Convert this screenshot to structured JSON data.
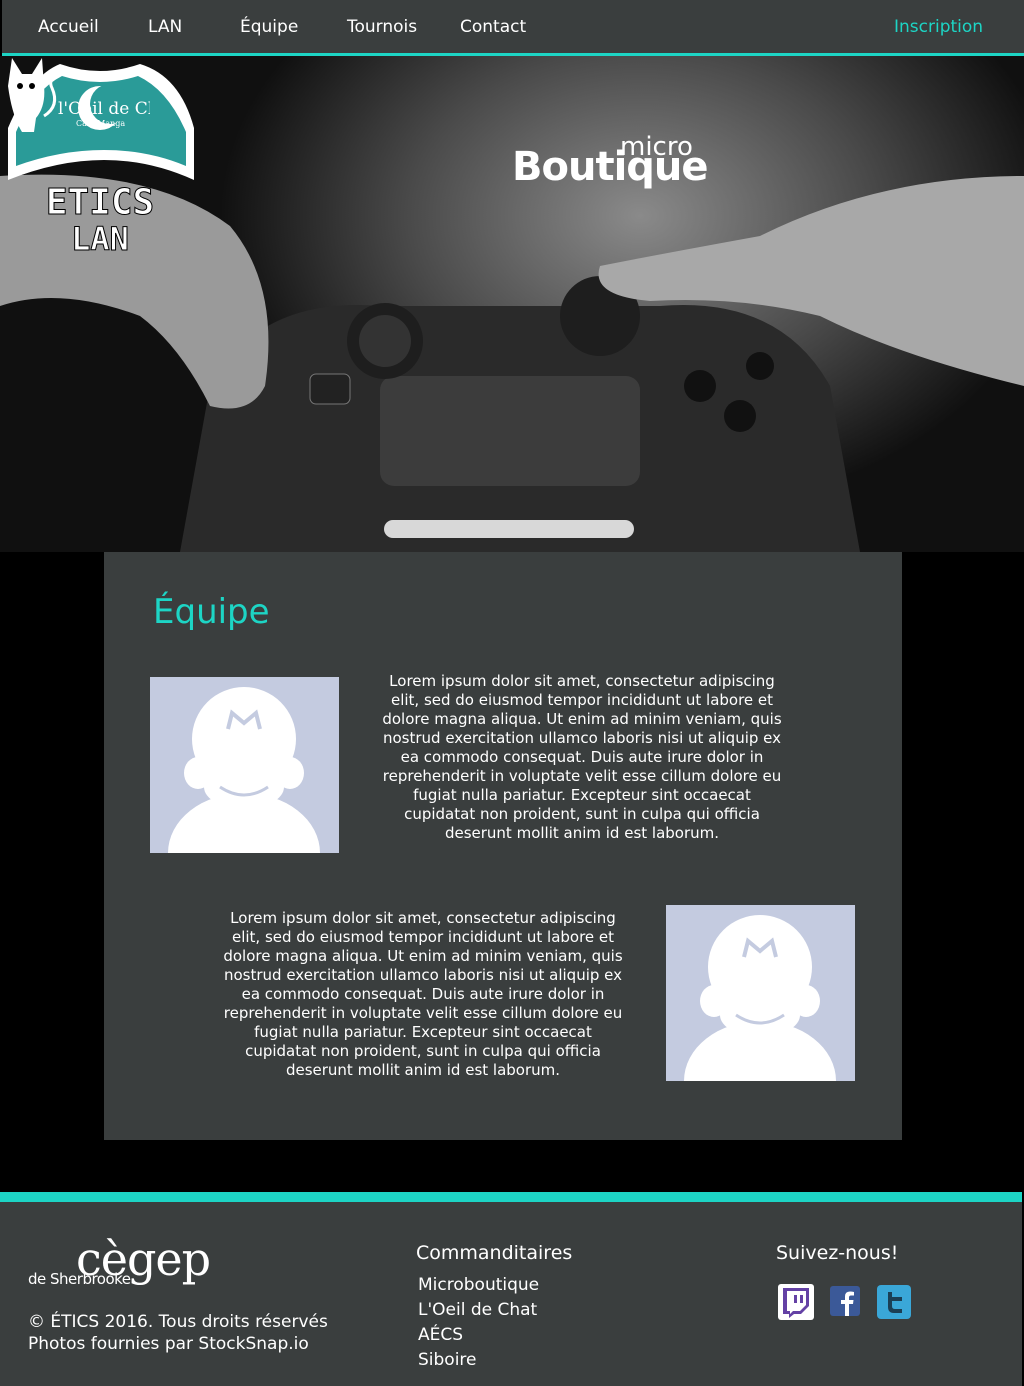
{
  "nav": {
    "items": [
      "Accueil",
      "LAN",
      "Équipe",
      "Tournois",
      "Contact"
    ],
    "signup": "Inscription"
  },
  "hero": {
    "logo_etics_line1": "ETICS",
    "logo_etics_line2": "LAN",
    "micro_small": "micro",
    "micro_big": "Boutique",
    "chat_name": "l'Oeil de Chat",
    "chat_sub": "Café Manga"
  },
  "main": {
    "title": "Équipe",
    "members": [
      {
        "bio": "Lorem ipsum dolor sit amet, consectetur adipiscing elit, sed do eiusmod tempor incididunt ut labore et dolore magna aliqua. Ut enim ad minim veniam, quis nostrud exercitation ullamco laboris nisi ut aliquip ex ea commodo consequat. Duis aute irure dolor in reprehenderit in voluptate velit esse cillum dolore eu fugiat nulla pariatur. Excepteur sint occaecat cupidatat non proident, sunt in culpa qui officia deserunt mollit anim id est laborum."
      },
      {
        "bio": "Lorem ipsum dolor sit amet, consectetur adipiscing elit, sed do eiusmod tempor incididunt ut labore et dolore magna aliqua. Ut enim ad minim veniam, quis nostrud exercitation ullamco laboris nisi ut aliquip ex ea commodo consequat. Duis aute irure dolor in reprehenderit in voluptate velit esse cillum dolore eu fugiat nulla pariatur. Excepteur sint occaecat cupidatat non proident, sunt in culpa qui officia deserunt mollit anim id est laborum."
      }
    ]
  },
  "footer": {
    "cegep_name": "cègep",
    "cegep_sub": "de Sherbrooke",
    "copyright": "© ÉTICS 2016. Tous droits réservés",
    "photos": "Photos fournies par StockSnap.io",
    "sponsors_title": "Commanditaires",
    "sponsors": [
      "Microboutique",
      "L'Oeil de Chat",
      "AÉCS",
      "Siboire"
    ],
    "follow_title": "Suivez-nous!",
    "social": [
      {
        "icon": "twitch-icon",
        "color": "#6441a5"
      },
      {
        "icon": "facebook-icon",
        "color": "#3b5998"
      },
      {
        "icon": "twitter-icon",
        "color": "#3aa7d8"
      }
    ]
  },
  "colors": {
    "accent": "#1dd5c5",
    "panel": "#3a3e3e",
    "avatar_bg": "#c4cbe0"
  }
}
